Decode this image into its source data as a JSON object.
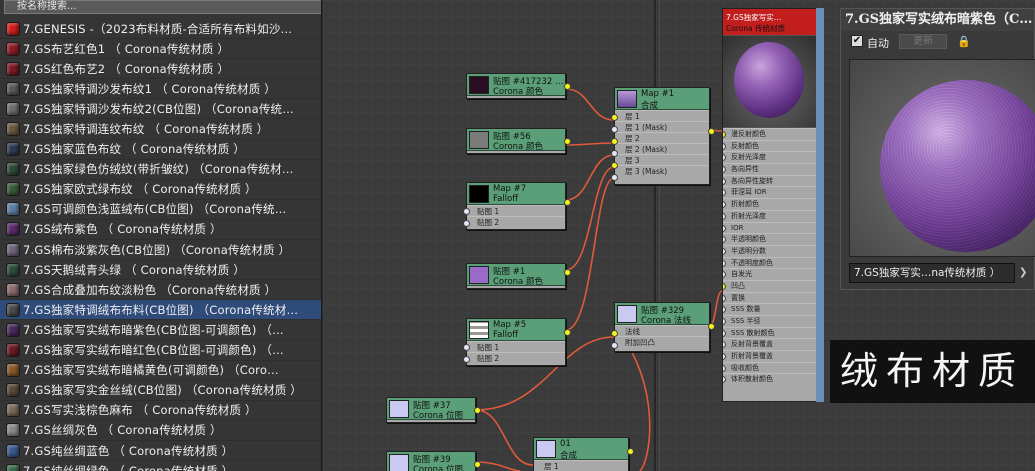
{
  "browser": {
    "search_label": "按名称搜索...",
    "materials": [
      {
        "label": "7.GENESIS  -（2023布料材质-合适所有布料如沙…",
        "color": "#d21c1c"
      },
      {
        "label": "7.GS布艺红色1   （ Corona传统材质 ）",
        "color": "#8c1e26"
      },
      {
        "label": "7.GS红色布艺2   （ Corona传统材质 ）",
        "color": "#7a1a22"
      },
      {
        "label": "7.GS独家特调沙发布纹1   （ Corona传统材质 ）",
        "color": "#5a5a5a"
      },
      {
        "label": "7.GS独家特调沙发布纹2(CB位图)   （Corona传统…",
        "color": "#6d6d6d"
      },
      {
        "label": "7.GS独家特调连纹布纹   （ Corona传统材质 ）",
        "color": "#6b5a40"
      },
      {
        "label": "7.GS独家蓝色布纹   （ Corona传统材质 ）",
        "color": "#2e3a55"
      },
      {
        "label": "7.GS独家绿色仿绒纹(带折皱纹)   （Corona传统材…",
        "color": "#2f4a38"
      },
      {
        "label": "7.GS独家欧式绿布纹   （ Corona传统材质 ）",
        "color": "#3a5a3a"
      },
      {
        "label": "7.GS可调颜色浅蓝绒布(CB位图)   （Corona传统…",
        "color": "#5a7fa0"
      },
      {
        "label": "7.GS绒布紫色   （ Corona传统材质 ）",
        "color": "#5a2a6a"
      },
      {
        "label": "7.GS棉布淡紫灰色(CB位图)   （Corona传统材质 ）",
        "color": "#6e6478"
      },
      {
        "label": "7.GS天鹅绒青头绿   （ Corona传统材质 ）",
        "color": "#2d4d3a"
      },
      {
        "label": "7.GS合成叠加布纹淡粉色   （Corona传统材质 ）",
        "color": "#8a6a6a"
      },
      {
        "label": "7.GS独家特调绒布布料(CB位图)   （Corona传统材…",
        "color": "#4a4a4a"
      },
      {
        "label": "7.GS独家写实绒布暗紫色(CB位图-可调颜色)   （…",
        "color": "#4a2a5a"
      },
      {
        "label": "7.GS独家写实绒布暗红色(CB位图-可调颜色)   （…",
        "color": "#6a1a22"
      },
      {
        "label": "7.GS独家写实绒布暗橘黄色(可调颜色)   （Coro…",
        "color": "#8a5a2a"
      },
      {
        "label": "7.GS独家写实金丝绒(CB位图)   （Corona传统材质 ）",
        "color": "#5a4a3a"
      },
      {
        "label": "7.GS写实浅棕色麻布   （ Corona传统材质 ）",
        "color": "#7a6a5a"
      },
      {
        "label": "7.GS丝绸灰色   （ Corona传统材质 ）",
        "color": "#8a8a8a"
      },
      {
        "label": "7.GS纯丝绸蓝色   （ Corona传统材质 ）",
        "color": "#3a5a8a"
      },
      {
        "label": "7.GS纯丝绸绿色   （ Corona传统材质 ）",
        "color": "#3a6a4a"
      }
    ],
    "selected_index": 14
  },
  "nodes": {
    "n1": {
      "t1": "贴图 #417232 …",
      "t2": "Corona 颜色",
      "swatch": "#2a0f22"
    },
    "n2": {
      "t1": "贴图 #56",
      "t2": "Corona 颜色",
      "swatch": "#7a7a7a"
    },
    "n3": {
      "t1": "Map #7",
      "t2": "Falloff",
      "swatch": "#000000",
      "slots": [
        "贴图 1",
        "贴图 2"
      ]
    },
    "n4": {
      "t1": "贴图 #1",
      "t2": "Corona 颜色",
      "swatch": "#9a6ac8"
    },
    "n5": {
      "t1": "Map #5",
      "t2": "Falloff",
      "swatch": "#cfcfcf",
      "slots": [
        "贴图 1",
        "贴图 2"
      ]
    },
    "n6": {
      "t1": "Map #1",
      "t2": "合成",
      "swatch": "#8a6ab8",
      "slots": [
        "层 1",
        "层 1 (Mask)",
        "层 2",
        "层 2 (Mask)",
        "层 3",
        "层 3 (Mask)"
      ]
    },
    "n7": {
      "t1": "贴图 #329",
      "t2": "Corona 法线",
      "swatch": "#c9c9f2",
      "slots": [
        "法线",
        "附加凹凸"
      ]
    },
    "n8": {
      "t1": "贴图 #37",
      "t2": "Corona 位图",
      "swatch": "#c9c9f2"
    },
    "n9": {
      "t1": "贴图 #39",
      "t2": "Corona 位图",
      "swatch": "#c9c9f2"
    },
    "n10": {
      "t1": "01",
      "t2": "合成",
      "swatch": "#c9c9f2",
      "slots": [
        "层 1"
      ]
    }
  },
  "material_node": {
    "title": "7.GS独家写实…",
    "subtitle": "Corona 传统材质",
    "slots": [
      "漫反射颜色",
      "反射颜色",
      "反射光泽度",
      "各向异性",
      "各向异性旋转",
      "菲涅耳 IOR",
      "折射颜色",
      "折射光泽度",
      "IOR",
      "半透明颜色",
      "半透明分数",
      "不透明度颜色",
      "自发光",
      "凹凸",
      "置换",
      "SSS 数量",
      "SSS 半径",
      "SSS 散射颜色",
      "反射背景覆盖",
      "折射背景覆盖",
      "吸收颜色",
      "体积散射颜色"
    ]
  },
  "preview_window": {
    "title": "7.GS独家写实绒布暗紫色（C…",
    "auto_label": "自动",
    "update_label": "更新",
    "material_name": "7.GS独家写实…na传统材质 ）"
  },
  "overlay_text": "绒布材质",
  "colors": {
    "node_header": "#5a9f78",
    "selection": "#2f4b7a",
    "material_header": "#c21e1e",
    "wire": "#e05a3a"
  }
}
